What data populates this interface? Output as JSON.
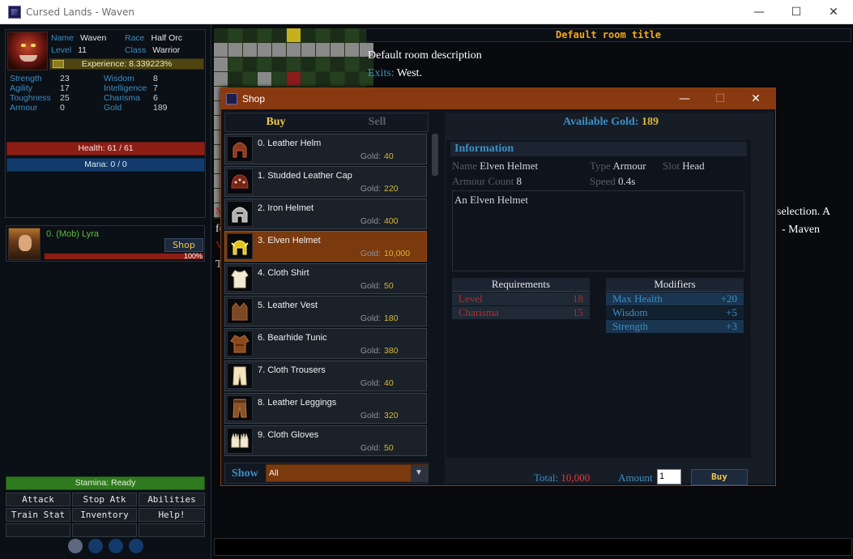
{
  "window": {
    "title": "Cursed Lands - Waven",
    "minimize": "—",
    "maximize": "☐",
    "close": "✕"
  },
  "character": {
    "name_label": "Name",
    "name": "Waven",
    "race_label": "Race",
    "race": "Half Orc",
    "level_label": "Level",
    "level": "11",
    "class_label": "Class",
    "class": "Warrior",
    "experience": "Experience: 8.339223%",
    "stats": {
      "strength_label": "Strength",
      "strength": "23",
      "agility_label": "Agility",
      "agility": "17",
      "toughness_label": "Toughness",
      "toughness": "25",
      "armour_label": "Armour",
      "armour": "0",
      "wisdom_label": "Wisdom",
      "wisdom": "8",
      "intelligence_label": "Intelligence",
      "intelligence": "7",
      "charisma_label": "Charisma",
      "charisma": "6",
      "gold_label": "Gold",
      "gold": "189"
    },
    "health": "Health: 61 / 61",
    "mana": "Mana: 0 / 0"
  },
  "target": {
    "name": "0. (Mob) Lyra",
    "shop_label": "Shop",
    "hp_text": "100%"
  },
  "stamina": "Stamina: Ready",
  "actions": {
    "attack": "Attack",
    "stop": "Stop Atk",
    "abilities": "Abilities",
    "train": "Train Stat",
    "inventory": "Inventory",
    "help": "Help!"
  },
  "room": {
    "title": "Default room title",
    "description": "Default room description",
    "exits_label": "Exits:",
    "exits": "West."
  },
  "chat_fragments": {
    "f1": "M",
    "f2": "fe",
    "f3": "V",
    "f4": "T",
    "f5": "selection. A",
    "f6": "- Maven"
  },
  "shop": {
    "title": "Shop",
    "tabs": {
      "buy": "Buy",
      "sell": "Sell"
    },
    "gold_label": "Gold:",
    "items": [
      {
        "name": "0. Leather Helm",
        "gold": "40"
      },
      {
        "name": "1. Studded Leather Cap",
        "gold": "220"
      },
      {
        "name": "2. Iron Helmet",
        "gold": "400"
      },
      {
        "name": "3. Elven Helmet",
        "gold": "10,000"
      },
      {
        "name": "4. Cloth Shirt",
        "gold": "50"
      },
      {
        "name": "5. Leather Vest",
        "gold": "180"
      },
      {
        "name": "6. Bearhide Tunic",
        "gold": "380"
      },
      {
        "name": "7. Cloth Trousers",
        "gold": "40"
      },
      {
        "name": "8. Leather Leggings",
        "gold": "320"
      },
      {
        "name": "9. Cloth Gloves",
        "gold": "50"
      }
    ],
    "show_label": "Show",
    "show_value": "All",
    "available_label": "Available Gold:",
    "available_gold": "189",
    "info": {
      "heading": "Information",
      "name_label": "Name",
      "name": "Elven Helmet",
      "type_label": "Type",
      "type": "Armour",
      "slot_label": "Slot",
      "slot": "Head",
      "count_label": "Armour Count",
      "count": "8",
      "speed_label": "Speed",
      "speed": "0.4s",
      "description": "An Elven Helmet"
    },
    "requirements": {
      "heading": "Requirements",
      "rows": [
        {
          "label": "Level",
          "value": "18"
        },
        {
          "label": "Charisma",
          "value": "15"
        }
      ]
    },
    "modifiers": {
      "heading": "Modifiers",
      "rows": [
        {
          "label": "Max Health",
          "value": "+20"
        },
        {
          "label": "Wisdom",
          "value": "+5"
        },
        {
          "label": "Strength",
          "value": "+3"
        }
      ]
    },
    "total_label": "Total:",
    "total": "10,000",
    "amount_label": "Amount",
    "amount": "1",
    "buy_label": "Buy"
  }
}
